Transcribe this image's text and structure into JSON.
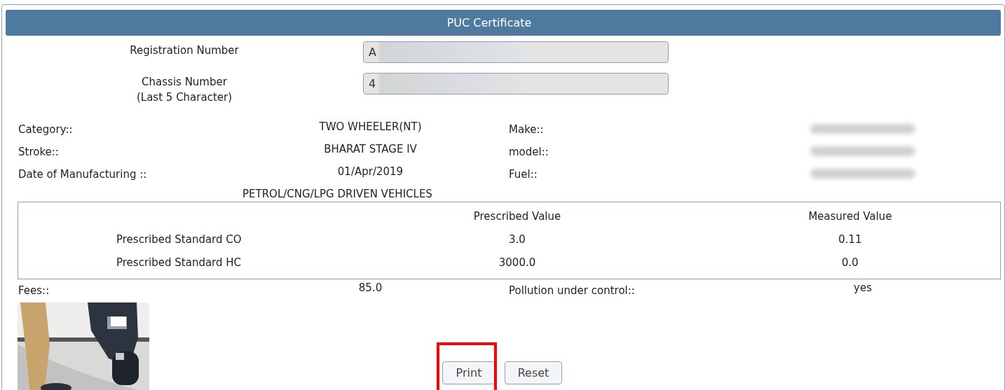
{
  "panel": {
    "title": "PUC Certificate"
  },
  "form_fields": [
    {
      "label": "Registration Number",
      "value": "A",
      "redacted": true
    },
    {
      "label": "Chassis Number\n(Last 5 Character)",
      "value": "4",
      "redacted": true
    }
  ],
  "details": [
    {
      "label": "Category::",
      "value": "TWO WHEELER(NT)",
      "label_2": "Make::",
      "value_2_redacted": true
    },
    {
      "label": "Stroke::",
      "value": "BHARAT STAGE IV",
      "label_2": "model::",
      "value_2_redacted": true
    },
    {
      "label": "Date of Manufacturing ::",
      "value": "01/Apr/2019",
      "label_2": "Fuel::",
      "value_2_redacted": true
    }
  ],
  "emission_table": {
    "caption": "PETROL/CNG/LPG DRIVEN VEHICLES",
    "columns": [
      "Prescribed Value",
      "Measured Value"
    ],
    "rows": [
      {
        "label": "Prescribed Standard CO",
        "prescribed": "3.0",
        "measured": "0.11"
      },
      {
        "label": "Prescribed Standard HC",
        "prescribed": "3000.0",
        "measured": "0.0"
      }
    ]
  },
  "fees": {
    "label": "Fees::",
    "value": "85.0",
    "label_2": "Pollution under control::",
    "value_2": "yes"
  },
  "buttons": [
    {
      "label": "Print",
      "highlighted": true
    },
    {
      "label": "Reset",
      "highlighted": false
    }
  ]
}
